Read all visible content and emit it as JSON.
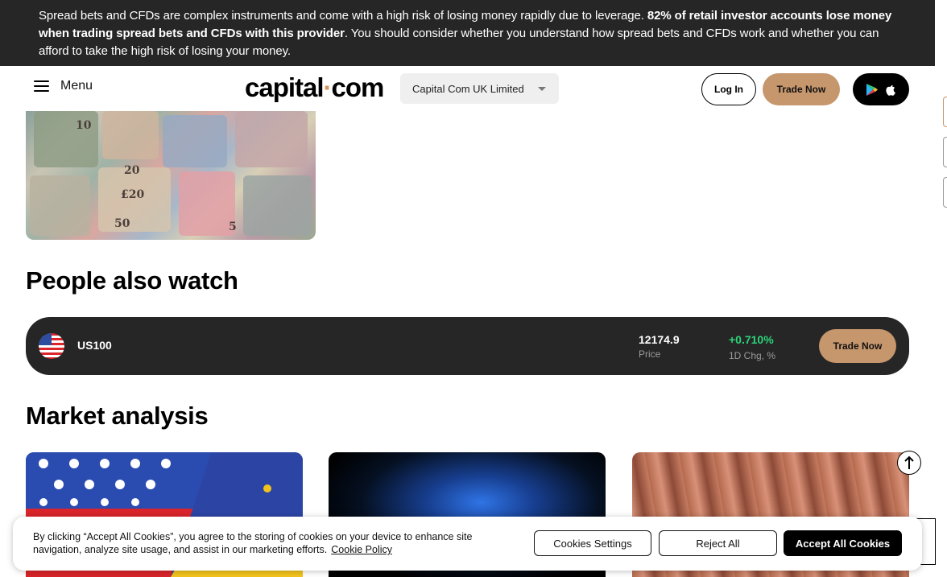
{
  "risk_banner": {
    "text_before": "Spread bets and CFDs are complex instruments and come with a high risk of losing money rapidly due to leverage. ",
    "text_bold": "82% of retail investor accounts lose money when trading spread bets and CFDs with this provider",
    "text_after": ". You should consider whether you understand how spread bets and CFDs work and whether you can afford to take the high risk of losing your money."
  },
  "header": {
    "menu_label": "Menu",
    "logo_part1": "capital",
    "logo_dot": "·",
    "logo_part2": "com",
    "entity_select": "Capital Com UK Limited",
    "login_label": "Log In",
    "trade_label": "Trade Now"
  },
  "puzzle_image": {
    "note_labels": [
      "10",
      "20",
      "£20",
      "50",
      "5"
    ]
  },
  "sections": {
    "people_also_watch": "People also watch",
    "market_analysis": "Market analysis"
  },
  "watch_row": {
    "symbol": "US100",
    "price": "12174.9",
    "price_caption": "Price",
    "change": "+0.710%",
    "change_caption": "1D Chg, %",
    "trade_label": "Trade Now"
  },
  "cookie": {
    "text": "By clicking “Accept All Cookies”, you agree to the storing of cookies on your device to enhance site navigation, analyze site usage, and assist in our marketing efforts.",
    "policy_link": "Cookie Policy",
    "settings_label": "Cookies Settings",
    "reject_label": "Reject All",
    "accept_label": "Accept All Cookies"
  },
  "colors": {
    "banner_bg": "#262626",
    "accent": "#c6966c",
    "positive": "#2bd47a"
  }
}
